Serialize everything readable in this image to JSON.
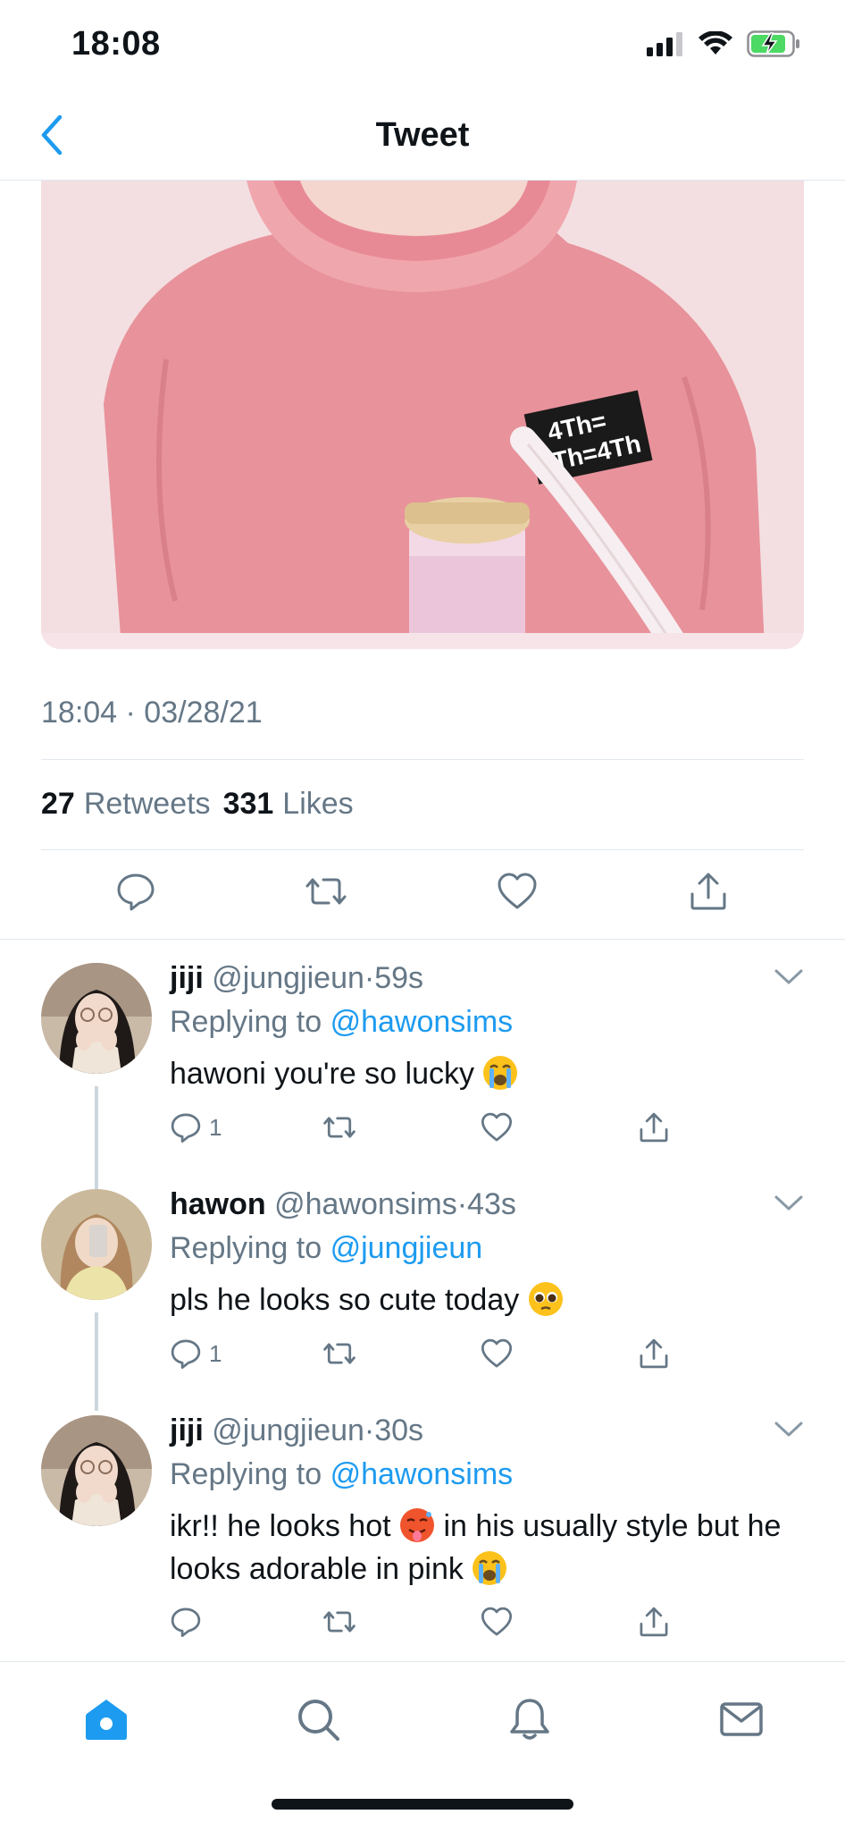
{
  "status_bar": {
    "time": "18:08",
    "icons": [
      "signal-icon",
      "wifi-icon",
      "battery-charging-icon"
    ]
  },
  "header": {
    "title": "Tweet",
    "back_icon": "chevron-left-icon"
  },
  "tweet": {
    "media_text_patch": [
      "4Th=",
      "4Th=4Th"
    ],
    "timestamp": "18:04 · 03/28/21",
    "retweets_count": "27",
    "retweets_label": "Retweets",
    "likes_count": "331",
    "likes_label": "Likes",
    "actions": [
      "reply-icon",
      "retweet-icon",
      "like-icon",
      "share-icon"
    ]
  },
  "replies": [
    {
      "name": "jiji",
      "handle": "@jungjieun",
      "time": "59s",
      "replying_label": "Replying to",
      "replying_to": "@hawonsims",
      "text": "hawoni you're so lucky",
      "emoji": "loudly-crying-face",
      "reply_count": "1"
    },
    {
      "name": "hawon",
      "handle": "@hawonsims",
      "time": "43s",
      "replying_label": "Replying to",
      "replying_to": "@jungjieun",
      "text": "pls he looks so cute today",
      "emoji": "pleading-face",
      "reply_count": "1"
    },
    {
      "name": "jiji",
      "handle": "@jungjieun",
      "time": "30s",
      "replying_label": "Replying to",
      "replying_to": "@hawonsims",
      "text_part1": "ikr!! he looks hot",
      "text_part2": "in his usually style but he looks adorable in pink",
      "emoji1": "hot-face",
      "emoji2": "loudly-crying-face",
      "reply_count": ""
    }
  ],
  "tab_bar": {
    "tabs": [
      "home-icon",
      "search-icon",
      "notifications-icon",
      "messages-icon"
    ],
    "active": "home-icon"
  },
  "colors": {
    "accent": "#1d9bf0",
    "secondary_text": "#657786",
    "divider": "#e1e8ed",
    "sweater": "#e88f99",
    "battery": "#4cd964"
  }
}
